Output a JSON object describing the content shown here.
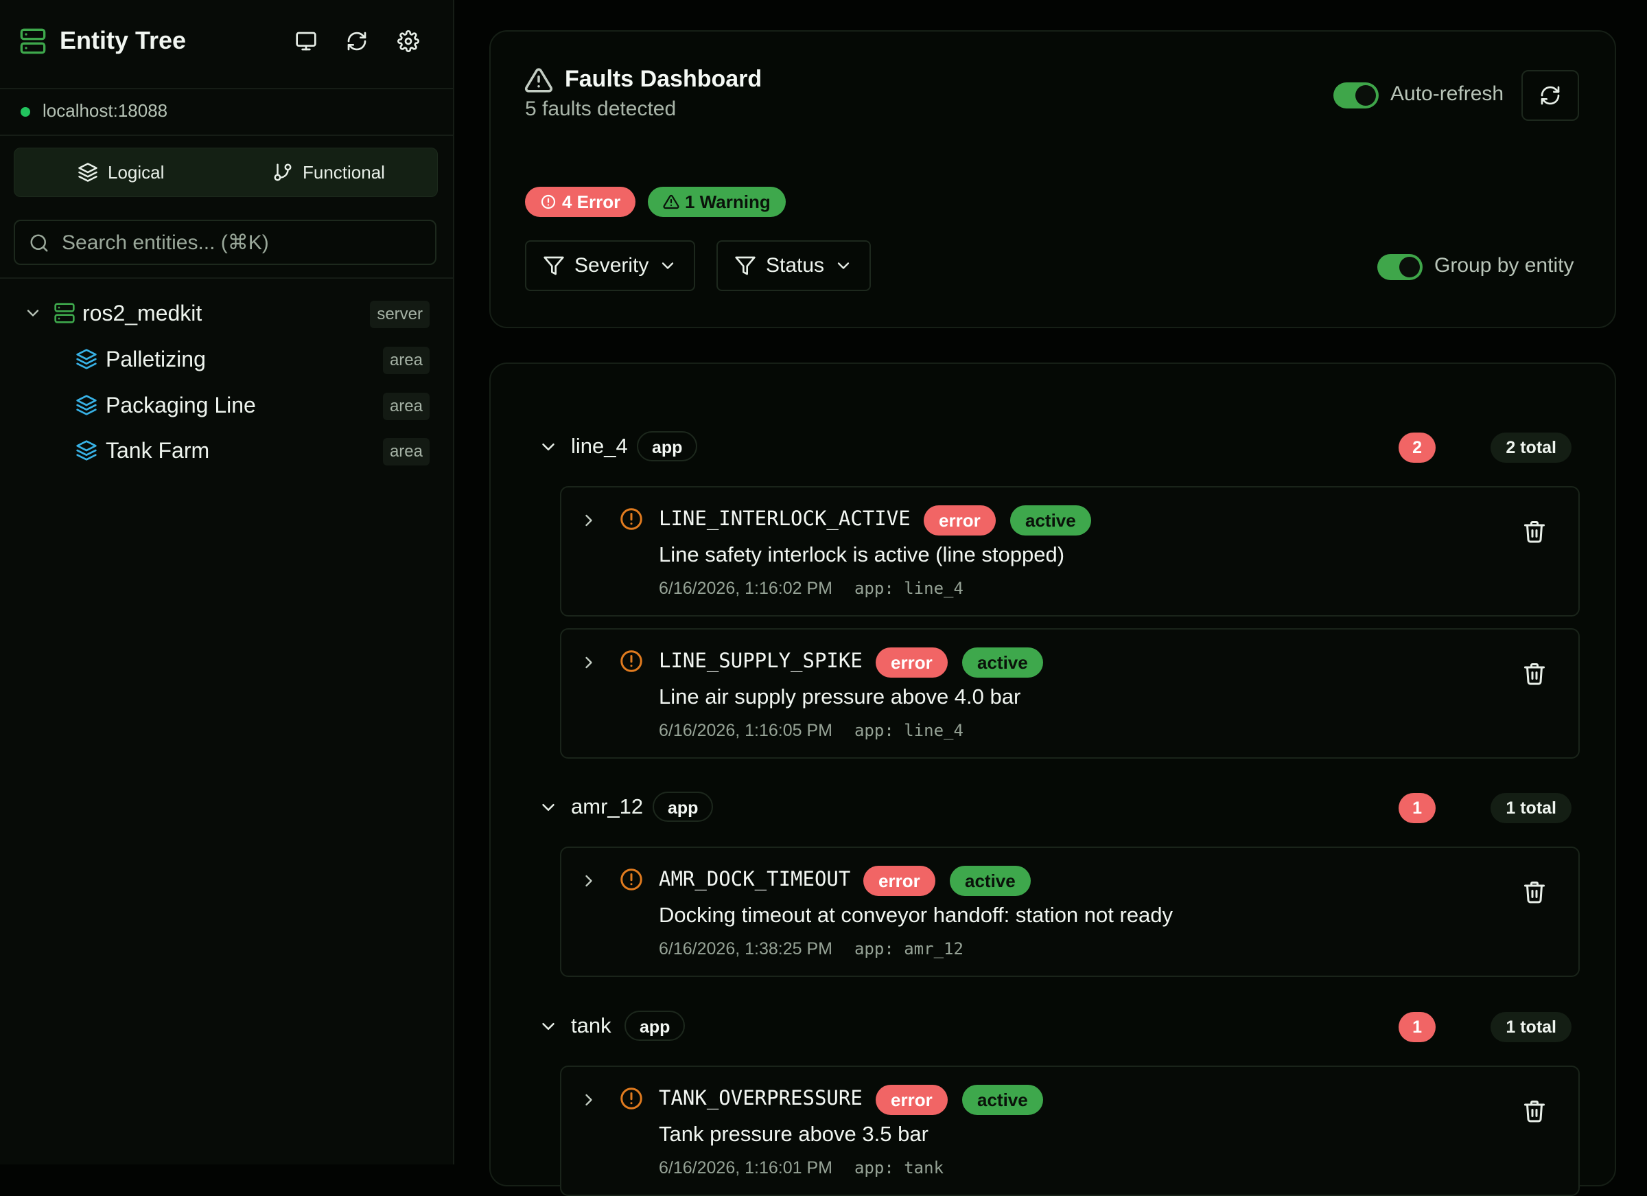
{
  "sidebar": {
    "title": "Entity Tree",
    "connection": "localhost:18088",
    "view_toggle": {
      "logical": "Logical",
      "functional": "Functional"
    },
    "search_placeholder": "Search entities... (⌘K)",
    "tree": {
      "root": {
        "label": "ros2_medkit",
        "tag": "server"
      },
      "children": [
        {
          "label": "Palletizing",
          "tag": "area"
        },
        {
          "label": "Packaging Line",
          "tag": "area"
        },
        {
          "label": "Tank Farm",
          "tag": "area"
        }
      ]
    }
  },
  "dashboard": {
    "title": "Faults Dashboard",
    "subtitle": "5 faults detected",
    "auto_refresh_label": "Auto-refresh",
    "error_count": "4 Error",
    "warning_count": "1 Warning",
    "filters": {
      "severity": "Severity",
      "status": "Status"
    },
    "group_by_label": "Group by entity"
  },
  "groups": [
    {
      "name": "line_4",
      "type": "app",
      "count": "2",
      "total": "2 total",
      "faults": [
        {
          "code": "LINE_INTERLOCK_ACTIVE",
          "severity": "error",
          "status": "active",
          "message": "Line safety interlock is active (line stopped)",
          "timestamp": "6/16/2026, 1:16:02 PM",
          "source": "app: line_4"
        },
        {
          "code": "LINE_SUPPLY_SPIKE",
          "severity": "error",
          "status": "active",
          "message": "Line air supply pressure above 4.0 bar",
          "timestamp": "6/16/2026, 1:16:05 PM",
          "source": "app: line_4"
        }
      ]
    },
    {
      "name": "amr_12",
      "type": "app",
      "count": "1",
      "total": "1 total",
      "faults": [
        {
          "code": "AMR_DOCK_TIMEOUT",
          "severity": "error",
          "status": "active",
          "message": "Docking timeout at conveyor handoff: station not ready",
          "timestamp": "6/16/2026, 1:38:25 PM",
          "source": "app: amr_12"
        }
      ]
    },
    {
      "name": "tank",
      "type": "app",
      "count": "1",
      "total": "1 total",
      "faults": [
        {
          "code": "TANK_OVERPRESSURE",
          "severity": "error",
          "status": "active",
          "message": "Tank pressure above 3.5 bar",
          "timestamp": "6/16/2026, 1:16:01 PM",
          "source": "app: tank"
        }
      ]
    }
  ],
  "colors": {
    "accent_green": "#3ea84c",
    "error_red": "#f16565",
    "warning_orange": "#e07b1f",
    "area_blue": "#38b2e6"
  }
}
